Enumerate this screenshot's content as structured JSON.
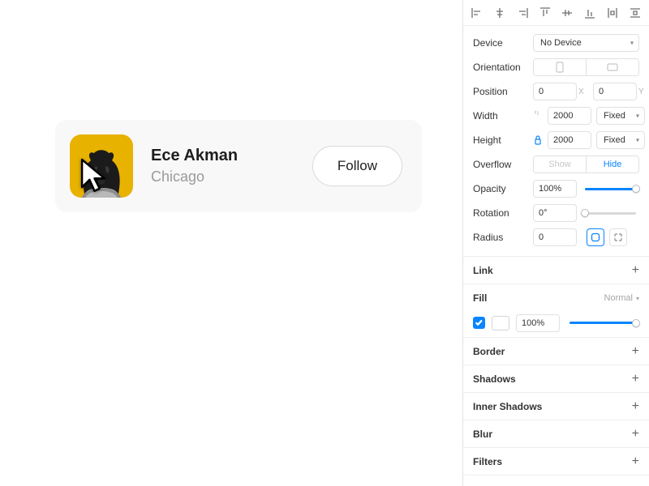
{
  "card": {
    "name": "Ece Akman",
    "location": "Chicago",
    "follow_label": "Follow"
  },
  "panel": {
    "device": {
      "label": "Device",
      "value": "No Device"
    },
    "orientation": {
      "label": "Orientation"
    },
    "position": {
      "label": "Position",
      "x": "0",
      "y": "0"
    },
    "width": {
      "label": "Width",
      "value": "2000",
      "mode": "Fixed"
    },
    "height": {
      "label": "Height",
      "value": "2000",
      "mode": "Fixed"
    },
    "overflow": {
      "label": "Overflow",
      "show": "Show",
      "hide": "Hide",
      "active": "hide"
    },
    "opacity": {
      "label": "Opacity",
      "value": "100%",
      "pct": 100
    },
    "rotation": {
      "label": "Rotation",
      "value": "0°",
      "pct": 0
    },
    "radius": {
      "label": "Radius",
      "value": "0"
    },
    "sections": {
      "link": "Link",
      "fill": "Fill",
      "fill_mode": "Normal",
      "fill_opacity": "100%",
      "fill_opacity_pct": 100,
      "border": "Border",
      "shadows": "Shadows",
      "inner_shadows": "Inner Shadows",
      "blur": "Blur",
      "filters": "Filters"
    }
  }
}
